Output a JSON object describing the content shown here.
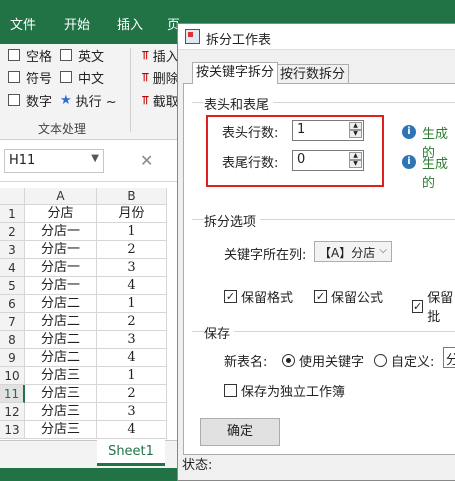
{
  "ribbon": {
    "tabs": [
      "文件",
      "开始",
      "插入",
      "页"
    ],
    "items": [
      "空格",
      "英文",
      "符号",
      "中文",
      "数字",
      "执行 ~",
      "插入",
      "删除",
      "截取"
    ],
    "group_label": "文本处理"
  },
  "formula": {
    "name_box": "H11",
    "cancel_symbol": "✕"
  },
  "sheet": {
    "columns": [
      "A",
      "B"
    ],
    "rows": [
      {
        "n": "1",
        "a": "分店",
        "b": "月份"
      },
      {
        "n": "2",
        "a": "分店一",
        "b": "1"
      },
      {
        "n": "3",
        "a": "分店一",
        "b": "2"
      },
      {
        "n": "4",
        "a": "分店一",
        "b": "3"
      },
      {
        "n": "5",
        "a": "分店一",
        "b": "4"
      },
      {
        "n": "6",
        "a": "分店二",
        "b": "1"
      },
      {
        "n": "7",
        "a": "分店二",
        "b": "2"
      },
      {
        "n": "8",
        "a": "分店二",
        "b": "3"
      },
      {
        "n": "9",
        "a": "分店二",
        "b": "4"
      },
      {
        "n": "10",
        "a": "分店三",
        "b": "1"
      },
      {
        "n": "11",
        "a": "分店三",
        "b": "2"
      },
      {
        "n": "12",
        "a": "分店三",
        "b": "3"
      },
      {
        "n": "13",
        "a": "分店三",
        "b": "4"
      }
    ],
    "tab_name": "Sheet1"
  },
  "dialog": {
    "title": "拆分工作表",
    "tabs": [
      "按关键字拆分",
      "按行数拆分"
    ],
    "header_footer": {
      "section": "表头和表尾",
      "header_label": "表头行数:",
      "header_value": "1",
      "footer_label": "表尾行数:",
      "footer_value": "0",
      "info_1": "生成的",
      "info_2": "生成的"
    },
    "split_options": {
      "section": "拆分选项",
      "key_column_label": "关键字所在列:",
      "key_column_value": "【A】分店",
      "keep_format": "保留格式",
      "keep_formula": "保留公式",
      "keep_other": "保留批"
    },
    "save": {
      "section": "保存",
      "new_name_label": "新表名:",
      "use_keyword": "使用关键字",
      "custom": "自定义:",
      "custom_value": "分",
      "separate_workbook": "保存为独立工作簿"
    },
    "ok_button": "确定",
    "status_label": "状态:"
  },
  "colors": {
    "excel_green": "#217346",
    "highlight_red": "#e02020",
    "info_green": "#2e7d32"
  }
}
